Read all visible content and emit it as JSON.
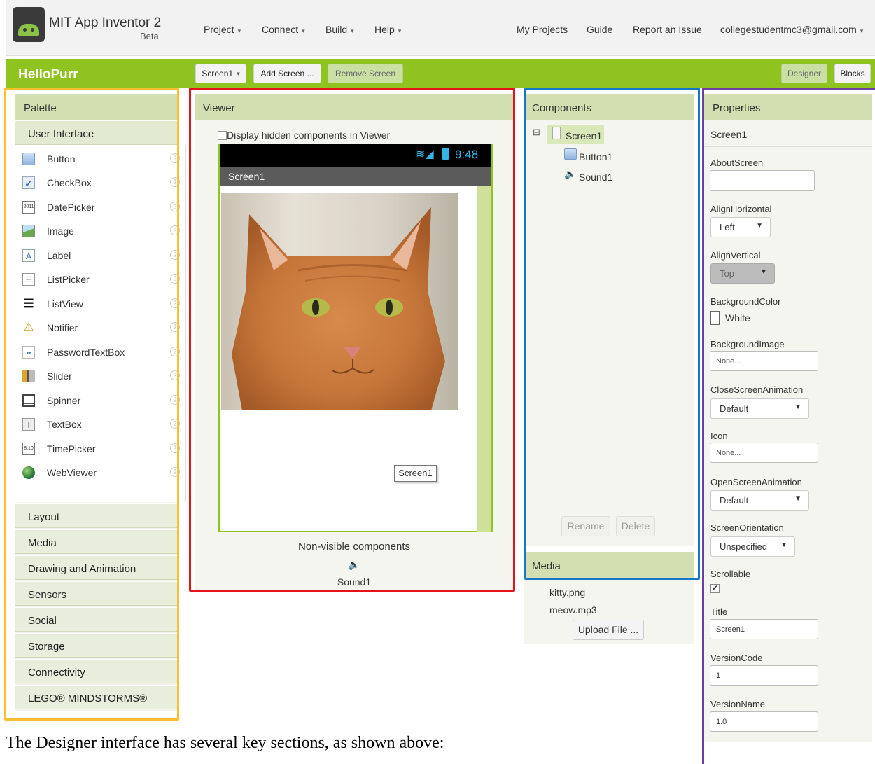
{
  "app": {
    "title": "MIT App Inventor 2",
    "badge": "Beta"
  },
  "menus": [
    "Project",
    "Connect",
    "Build",
    "Help"
  ],
  "right_links": [
    "My Projects",
    "Guide",
    "Report an Issue"
  ],
  "account": "collegestudentmc3@gmail.com",
  "project": {
    "name": "HelloPurr",
    "screen_select": "Screen1",
    "add_screen": "Add Screen ...",
    "remove_screen": "Remove Screen",
    "designer": "Designer",
    "blocks": "Blocks"
  },
  "palette": {
    "header": "Palette",
    "open_category": "User Interface",
    "items": [
      {
        "label": "Button",
        "icon": "button-icon"
      },
      {
        "label": "CheckBox",
        "icon": "checkbox-icon"
      },
      {
        "label": "DatePicker",
        "icon": "calendar-icon"
      },
      {
        "label": "Image",
        "icon": "image-icon"
      },
      {
        "label": "Label",
        "icon": "label-icon"
      },
      {
        "label": "ListPicker",
        "icon": "list-picker-icon"
      },
      {
        "label": "ListView",
        "icon": "list-view-icon"
      },
      {
        "label": "Notifier",
        "icon": "warning-icon"
      },
      {
        "label": "PasswordTextBox",
        "icon": "password-icon"
      },
      {
        "label": "Slider",
        "icon": "slider-icon"
      },
      {
        "label": "Spinner",
        "icon": "spinner-icon"
      },
      {
        "label": "TextBox",
        "icon": "textbox-icon"
      },
      {
        "label": "TimePicker",
        "icon": "clock-icon"
      },
      {
        "label": "WebViewer",
        "icon": "globe-icon"
      }
    ],
    "help_glyph": "?",
    "categories": [
      "Layout",
      "Media",
      "Drawing and Animation",
      "Sensors",
      "Social",
      "Storage",
      "Connectivity",
      "LEGO® MINDSTORMS®"
    ]
  },
  "viewer": {
    "header": "Viewer",
    "hidden_checkbox_label": "Display hidden components in Viewer",
    "time": "9:48",
    "screen_title": "Screen1",
    "tooltip": "Screen1",
    "nonvisible_label": "Non-visible components",
    "nonvisible_item": "Sound1"
  },
  "components": {
    "header": "Components",
    "tree": [
      "Screen1",
      "Button1",
      "Sound1"
    ],
    "collapse_glyph": "⊟",
    "rename": "Rename",
    "delete": "Delete"
  },
  "media": {
    "header": "Media",
    "files": [
      "kitty.png",
      "meow.mp3"
    ],
    "upload": "Upload File ..."
  },
  "properties": {
    "header": "Properties",
    "component": "Screen1",
    "about_label": "AboutScreen",
    "about_value": "",
    "align_h_label": "AlignHorizontal",
    "align_h_value": "Left",
    "align_v_label": "AlignVertical",
    "align_v_value": "Top",
    "bgcolor_label": "BackgroundColor",
    "bgcolor_value": "White",
    "bgimage_label": "BackgroundImage",
    "bgimage_value": "None...",
    "close_anim_label": "CloseScreenAnimation",
    "close_anim_value": "Default",
    "icon_label": "Icon",
    "icon_value": "None...",
    "open_anim_label": "OpenScreenAnimation",
    "open_anim_value": "Default",
    "orientation_label": "ScreenOrientation",
    "orientation_value": "Unspecified",
    "scrollable_label": "Scrollable",
    "scrollable_checked": true,
    "title_label": "Title",
    "title_value": "Screen1",
    "vcode_label": "VersionCode",
    "vcode_value": "1",
    "vname_label": "VersionName",
    "vname_value": "1.0"
  },
  "caption": "The Designer interface has several key sections, as shown above:",
  "colors": {
    "green_bar": "#8fc31f",
    "palette_outline": "#fdbf2d",
    "viewer_outline": "#e3151a",
    "components_outline": "#1677c8",
    "properties_outline": "#6b3fa0"
  }
}
